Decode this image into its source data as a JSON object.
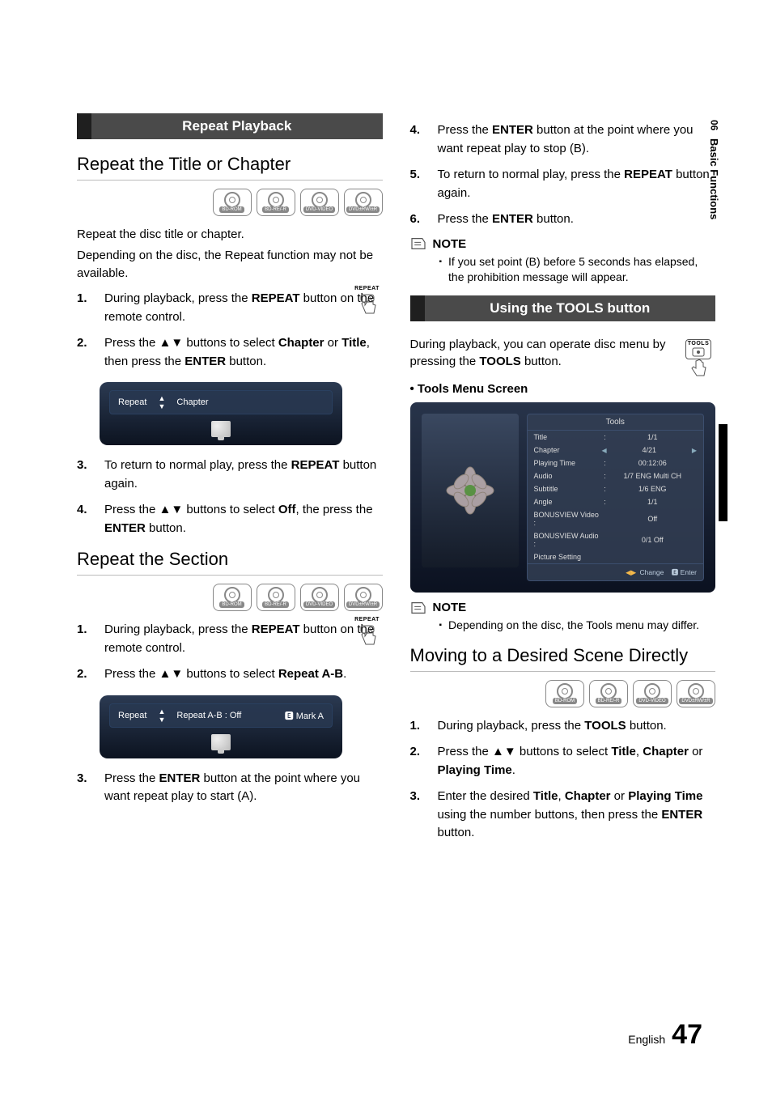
{
  "side": {
    "chapter_num": "06",
    "chapter_name": "Basic Functions"
  },
  "footer": {
    "lang": "English",
    "page": "47"
  },
  "left": {
    "bar1": "Repeat Playback",
    "h2a": "Repeat the Title or Chapter",
    "discs": [
      "BD-ROM",
      "BD-RE/-R",
      "DVD-VIDEO",
      "DVD±RW/±R"
    ],
    "intro1": "Repeat the disc title or chapter.",
    "intro2": "Depending on the disc, the Repeat function may not be available.",
    "stepsA": [
      {
        "n": "1.",
        "html": "During playback, press the <b>REPEAT</b> button on the remote control.",
        "icon": "REPEAT"
      },
      {
        "n": "2.",
        "html": "Press the <span class='arrow'>▲▼</span> buttons to select <b>Chapter</b> or <b>Title</b>, then press the <b>ENTER</b> button."
      }
    ],
    "osd1": {
      "label": "Repeat",
      "value": "Chapter"
    },
    "stepsA2": [
      {
        "n": "3.",
        "html": "To return to normal play, press the <b>REPEAT</b> button again."
      },
      {
        "n": "4.",
        "html": "Press the <span class='arrow'>▲▼</span> buttons to select <b>Off</b>, the press the <b>ENTER</b> button."
      }
    ],
    "h2b": "Repeat the Section",
    "stepsB": [
      {
        "n": "1.",
        "html": "During playback, press the <b>REPEAT</b> button on the remote control.",
        "icon": "REPEAT"
      },
      {
        "n": "2.",
        "html": "Press the <span class='arrow'>▲▼</span> buttons to select <b>Repeat A-B</b>."
      }
    ],
    "osd2": {
      "label": "Repeat",
      "value": "Repeat A-B : Off",
      "mark": "Mark A"
    },
    "stepsB2": [
      {
        "n": "3.",
        "html": "Press the <b>ENTER</b> button at the point where you want repeat play to start (A)."
      }
    ]
  },
  "right": {
    "stepsC": [
      {
        "n": "4.",
        "html": "Press the <b>ENTER</b> button at the point where you want repeat play to stop (B)."
      },
      {
        "n": "5.",
        "html": "To return to normal play, press the <b>REPEAT</b> button again."
      },
      {
        "n": "6.",
        "html": "Press the <b>ENTER</b> button."
      }
    ],
    "note_label": "NOTE",
    "note_items_1": [
      "If you set point (B) before 5 seconds has elapsed, the prohibition message will appear."
    ],
    "bar2": "Using the TOOLS button",
    "tools_intro": "During playback, you can operate disc menu by pressing the <b>TOOLS</b> button.",
    "tools_icon_cap": "TOOLS",
    "tools_menu_head": "Tools Menu Screen",
    "tools_panel": {
      "title": "Tools",
      "rows": [
        {
          "k": "Title",
          "c": ":",
          "v": "1/1"
        },
        {
          "k": "Chapter",
          "c": "",
          "v": "4/21",
          "nav": true
        },
        {
          "k": "Playing Time",
          "c": ":",
          "v": "00:12:06"
        },
        {
          "k": "Audio",
          "c": ":",
          "v": "1/7 ENG Multi CH"
        },
        {
          "k": "Subtitle",
          "c": ":",
          "v": "1/6 ENG"
        },
        {
          "k": "Angle",
          "c": ":",
          "v": "1/1"
        },
        {
          "k": "BONUSVIEW Video :",
          "c": "",
          "v": "Off"
        },
        {
          "k": "BONUSVIEW Audio :",
          "c": "",
          "v": "0/1 Off"
        },
        {
          "k": "Picture Setting",
          "c": "",
          "v": ""
        }
      ],
      "footer_change": "Change",
      "footer_enter": "Enter"
    },
    "note_items_2": [
      "Depending on the disc, the Tools menu may differ."
    ],
    "h2c": "Moving to a Desired Scene Directly",
    "stepsD": [
      {
        "n": "1.",
        "html": "During playback, press the <b>TOOLS</b> button."
      },
      {
        "n": "2.",
        "html": "Press the <span class='arrow'>▲▼</span> buttons to select <b>Title</b>, <b>Chapter</b> or <b>Playing Time</b>."
      },
      {
        "n": "3.",
        "html": "Enter the desired <b>Title</b>, <b>Chapter</b> or <b>Playing Time</b> using the number buttons, then press the <b>ENTER</b> button."
      }
    ]
  }
}
